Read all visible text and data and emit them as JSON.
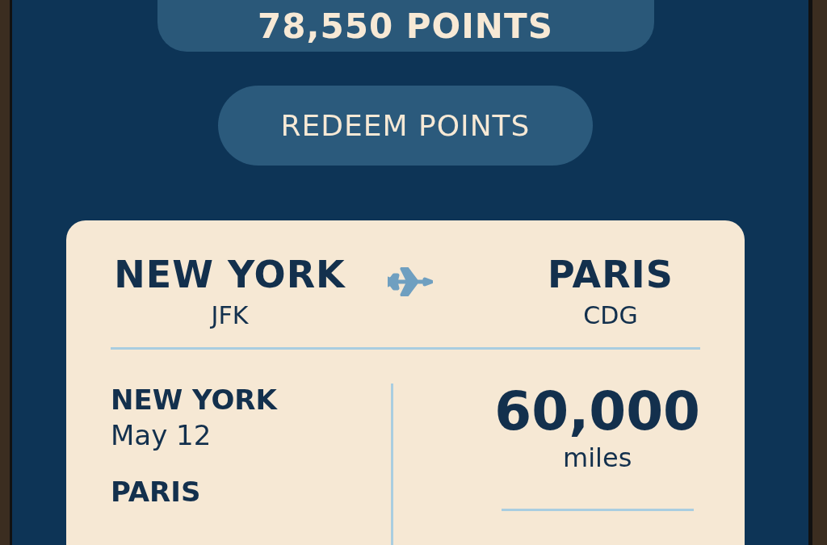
{
  "balance": {
    "text": "78,550 POINTS"
  },
  "redeem_button": {
    "label": "REDEEM POINTS"
  },
  "route": {
    "origin": {
      "city": "NEW YORK",
      "code": "JFK"
    },
    "destination": {
      "city": "PARIS",
      "code": "CDG"
    }
  },
  "itinerary": [
    {
      "city": "NEW YORK",
      "date": "May 12"
    },
    {
      "city": "PARIS"
    }
  ],
  "cost": {
    "amount": "60,000",
    "unit": "miles"
  }
}
